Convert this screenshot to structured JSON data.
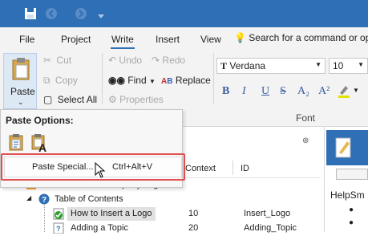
{
  "menu": {
    "file": "File",
    "project": "Project",
    "write": "Write",
    "insert": "Insert",
    "view": "View",
    "search_placeholder": "Search for a command or op"
  },
  "ribbon": {
    "paste": "Paste",
    "cut": "Cut",
    "copy": "Copy",
    "select_all": "Select All",
    "undo": "Undo",
    "redo": "Redo",
    "find": "Find",
    "replace": "Replace",
    "properties": "Properties",
    "font_name": "Verdana",
    "font_size": "10",
    "font_group": "Font",
    "format_buttons": [
      "B",
      "I",
      "U",
      "S",
      "A₂",
      "A²"
    ]
  },
  "paste_popup": {
    "title": "Paste Options:",
    "special_label": "Paste Special...",
    "special_shortcut": "Ctrl+Alt+V"
  },
  "grid": {
    "col_context": "Context",
    "col_id": "ID"
  },
  "tree": [
    {
      "label": "How to Insert a Company Logo",
      "context": "",
      "id": ""
    },
    {
      "label": "Table of Contents",
      "context": "",
      "id": ""
    },
    {
      "label": "How to Insert a Logo",
      "context": "10",
      "id": "Insert_Logo"
    },
    {
      "label": "Adding a Topic",
      "context": "20",
      "id": "Adding_Topic"
    }
  ],
  "right_pane": {
    "text": "HelpSm"
  },
  "colors": {
    "title_bar": "#2e6fb5",
    "highlight_box": "#e05050"
  }
}
